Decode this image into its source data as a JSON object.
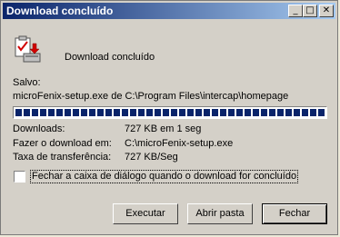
{
  "window": {
    "title": "Download concluído"
  },
  "titlebar_buttons": {
    "minimize": "_",
    "maximize": "□",
    "close": "✕"
  },
  "header": {
    "message": "Download concluído",
    "icon": "download-complete-icon"
  },
  "saved": {
    "label": "Salvo:",
    "path": "microFenix-setup.exe de C:\\Program Files\\intercap\\homepage"
  },
  "progress": {
    "percent": 100
  },
  "details": [
    {
      "label": "Downloads:",
      "value": "727 KB em 1 seg"
    },
    {
      "label": "Fazer o download em:",
      "value": "C:\\microFenix-setup.exe"
    },
    {
      "label": "Taxa de transferência:",
      "value": "727 KB/Seg"
    }
  ],
  "close_on_complete": {
    "label": "Fechar a caixa de diálogo quando o download for concluído",
    "checked": false
  },
  "buttons": {
    "run": "Executar",
    "open_folder": "Abrir pasta",
    "close": "Fechar"
  }
}
